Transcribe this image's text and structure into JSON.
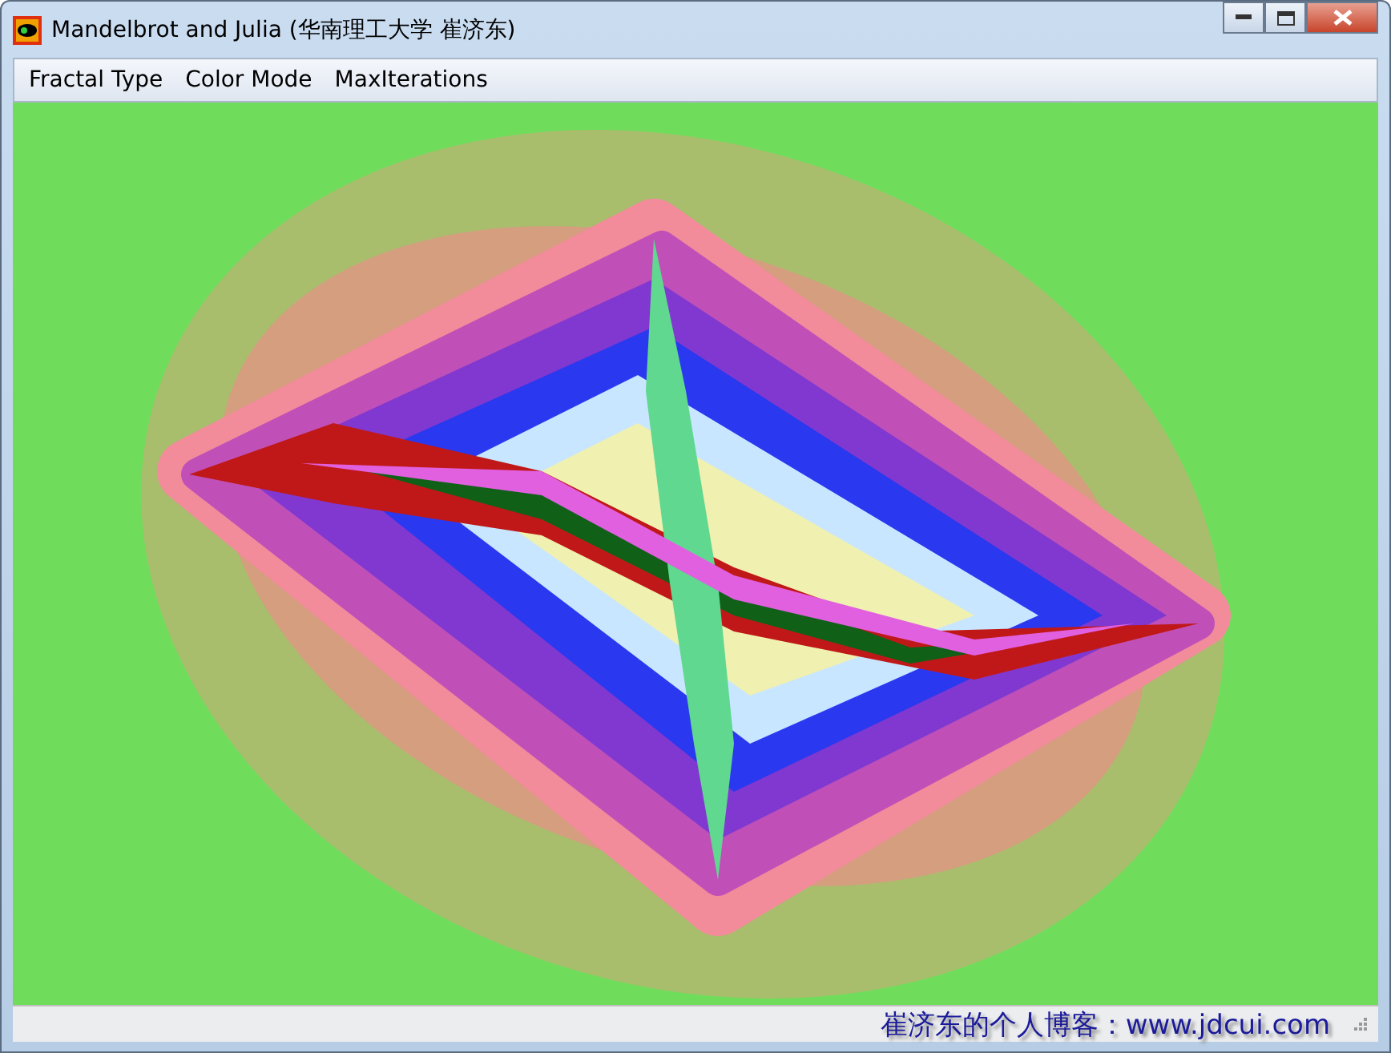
{
  "window": {
    "title": "Mandelbrot and Julia (华南理工大学 崔济东)"
  },
  "menu": [
    {
      "label": "Fractal Type"
    },
    {
      "label": "Color Mode"
    },
    {
      "label": "MaxIterations"
    }
  ],
  "status_bar": {
    "text": "崔济东的个人博客：www.jdcui.com"
  }
}
